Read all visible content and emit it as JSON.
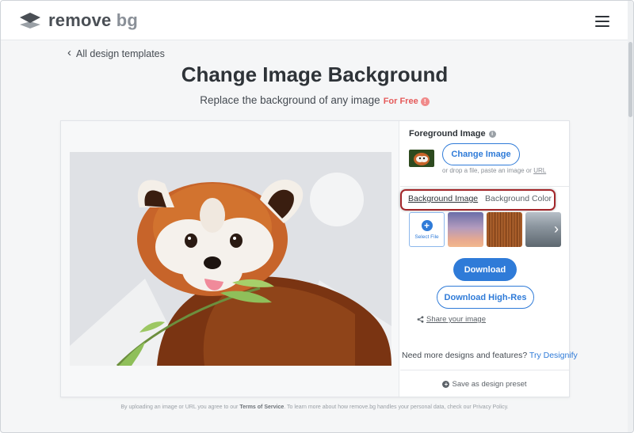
{
  "header": {
    "logo_word1": "remove",
    "logo_word2": "bg",
    "menu_icon": "hamburger-menu-icon"
  },
  "nav": {
    "back_label": "All design templates"
  },
  "hero": {
    "title": "Change Image Background",
    "subtitle": "Replace the background of any image",
    "free_badge": "For Free"
  },
  "panel": {
    "foreground_title": "Foreground Image",
    "change_image_label": "Change Image",
    "drop_hint": "or drop a file, paste an image or",
    "drop_hint_link": "URL",
    "tabs": [
      {
        "label": "Background Image",
        "active": true
      },
      {
        "label": "Background Color",
        "active": false
      }
    ],
    "select_file_label": "Select File",
    "download_label": "Download",
    "download_hr_label": "Download High-Res",
    "share_label": "Share your image",
    "more_text": "Need more designs and features?",
    "more_link": "Try Designify",
    "save_preset_label": "Save as design preset"
  },
  "footer": {
    "text_before": "By uploading an image or URL you agree to our",
    "tos": "Terms of Service",
    "text_after": ". To learn more about how remove.bg handles your personal data, check our Privacy Policy."
  },
  "colors": {
    "accent": "#2f7bd8",
    "highlight_box": "#a3262a",
    "free_badge": "#e55a5a"
  }
}
